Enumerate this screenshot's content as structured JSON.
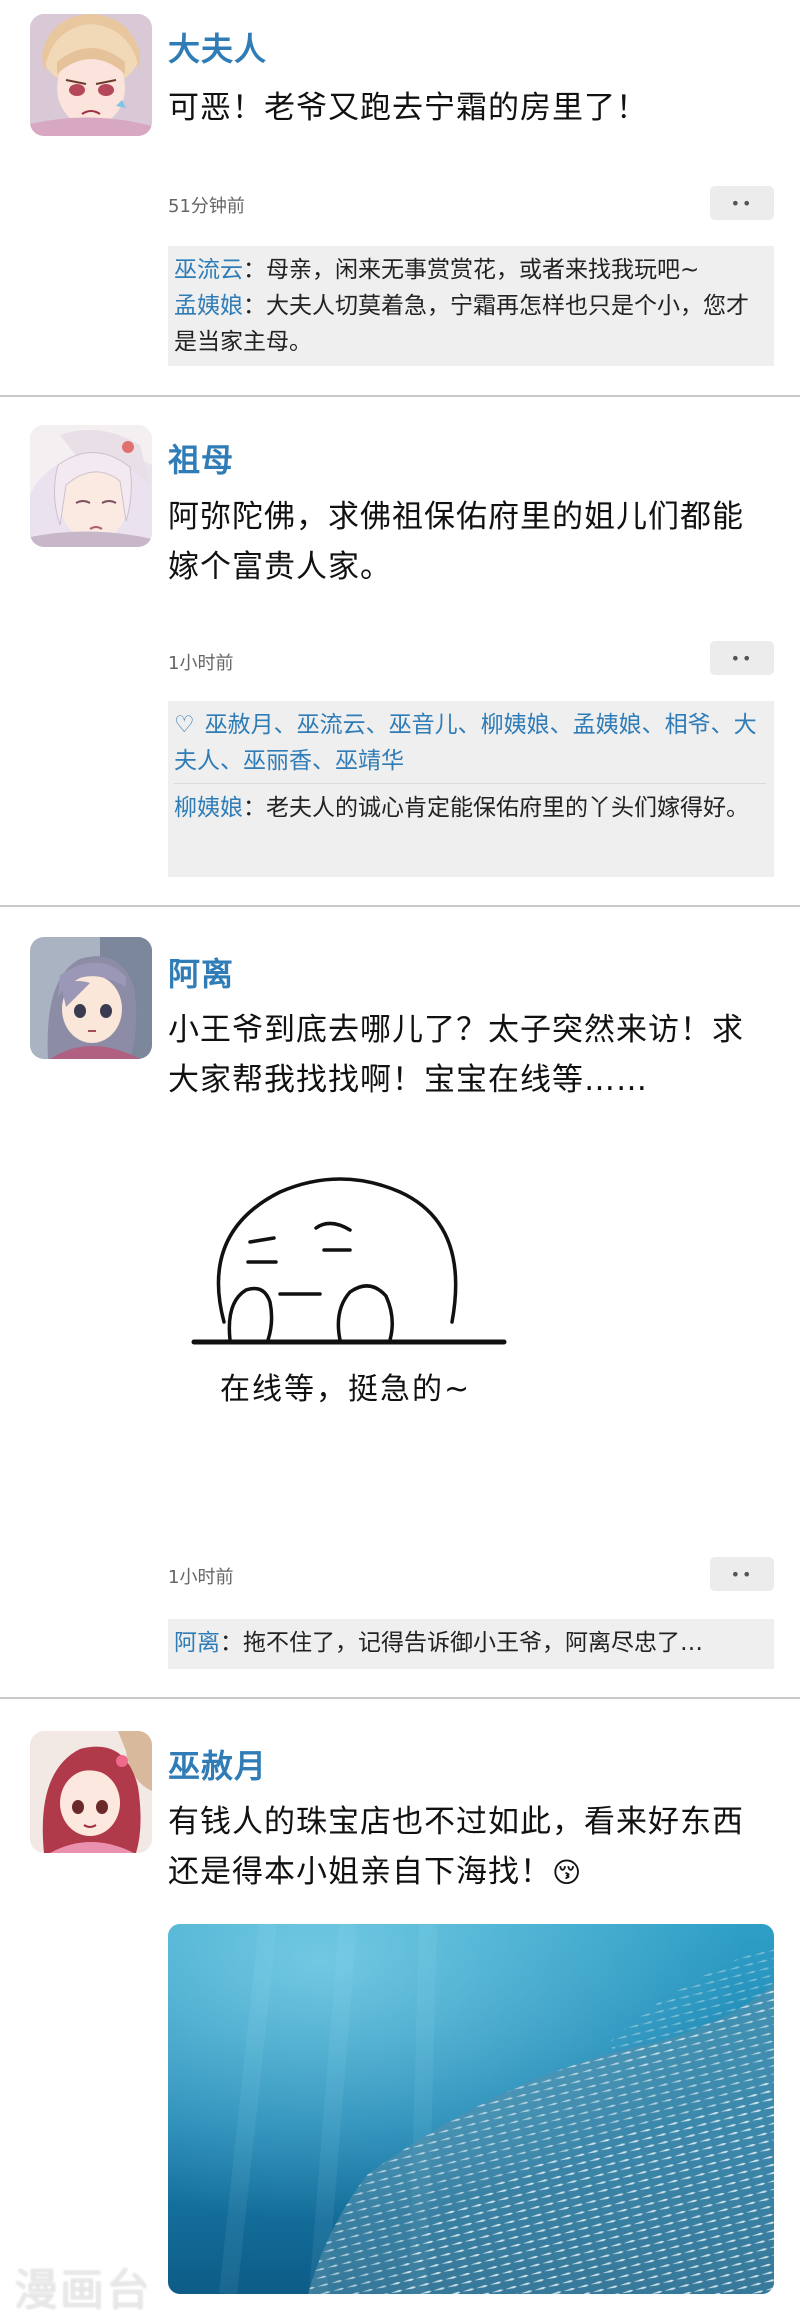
{
  "posts": [
    {
      "name": "大夫人",
      "text": "可恶！老爷又跑去宁霜的房里了！",
      "time": "51分钟前",
      "comments": [
        {
          "name": "巫流云",
          "sep": "：",
          "text": "母亲，闲来无事赏赏花，或者来找我玩吧~"
        },
        {
          "name": "孟姨娘",
          "sep": "：",
          "text": "大夫人切莫着急，宁霜再怎样也只是个小，您才是当家主母。"
        }
      ]
    },
    {
      "name": "祖母",
      "text": "阿弥陀佛，求佛祖保佑府里的姐儿们都能嫁个富贵人家。",
      "time": "1小时前",
      "likes": [
        "巫赦月",
        "巫流云",
        "巫音儿",
        "柳姨娘",
        "孟姨娘",
        "相爷",
        "大夫人",
        "巫丽香",
        "巫靖华"
      ],
      "comments": [
        {
          "name": "柳姨娘",
          "sep": "：",
          "text": "老夫人的诚心肯定能保佑府里的丫头们嫁得好。"
        }
      ]
    },
    {
      "name": "阿离",
      "text": "小王爷到底去哪儿了？太子突然来访！求大家帮我找找啊！宝宝在线等……",
      "meme_caption": "在线等，挺急的~",
      "time": "1小时前",
      "comments": [
        {
          "name": "阿离",
          "sep": "：",
          "text": "拖不住了，记得告诉御小王爷，阿离尽忠了…"
        }
      ]
    },
    {
      "name": "巫赦月",
      "text": "有钱人的珠宝店也不过如此，看来好东西还是得本小姐亲自下海找！",
      "emoji": "😚"
    }
  ],
  "more_label": "••",
  "likes_sep": "、",
  "watermark": "漫画台",
  "colors": {
    "name_blue": "#2f7cb6",
    "comment_bg": "#efefef",
    "divider": "#c8c8c8"
  },
  "icons": {
    "like": "heart-outline-icon",
    "more": "more-dots-icon"
  }
}
